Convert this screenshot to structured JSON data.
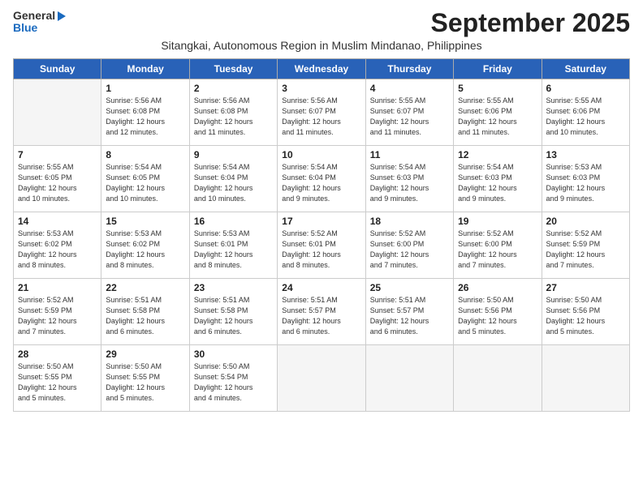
{
  "logo": {
    "general": "General",
    "blue": "Blue"
  },
  "title": "September 2025",
  "subtitle": "Sitangkai, Autonomous Region in Muslim Mindanao, Philippines",
  "days_of_week": [
    "Sunday",
    "Monday",
    "Tuesday",
    "Wednesday",
    "Thursday",
    "Friday",
    "Saturday"
  ],
  "weeks": [
    [
      {
        "day": "",
        "info": ""
      },
      {
        "day": "1",
        "info": "Sunrise: 5:56 AM\nSunset: 6:08 PM\nDaylight: 12 hours\nand 12 minutes."
      },
      {
        "day": "2",
        "info": "Sunrise: 5:56 AM\nSunset: 6:08 PM\nDaylight: 12 hours\nand 11 minutes."
      },
      {
        "day": "3",
        "info": "Sunrise: 5:56 AM\nSunset: 6:07 PM\nDaylight: 12 hours\nand 11 minutes."
      },
      {
        "day": "4",
        "info": "Sunrise: 5:55 AM\nSunset: 6:07 PM\nDaylight: 12 hours\nand 11 minutes."
      },
      {
        "day": "5",
        "info": "Sunrise: 5:55 AM\nSunset: 6:06 PM\nDaylight: 12 hours\nand 11 minutes."
      },
      {
        "day": "6",
        "info": "Sunrise: 5:55 AM\nSunset: 6:06 PM\nDaylight: 12 hours\nand 10 minutes."
      }
    ],
    [
      {
        "day": "7",
        "info": "Sunrise: 5:55 AM\nSunset: 6:05 PM\nDaylight: 12 hours\nand 10 minutes."
      },
      {
        "day": "8",
        "info": "Sunrise: 5:54 AM\nSunset: 6:05 PM\nDaylight: 12 hours\nand 10 minutes."
      },
      {
        "day": "9",
        "info": "Sunrise: 5:54 AM\nSunset: 6:04 PM\nDaylight: 12 hours\nand 10 minutes."
      },
      {
        "day": "10",
        "info": "Sunrise: 5:54 AM\nSunset: 6:04 PM\nDaylight: 12 hours\nand 9 minutes."
      },
      {
        "day": "11",
        "info": "Sunrise: 5:54 AM\nSunset: 6:03 PM\nDaylight: 12 hours\nand 9 minutes."
      },
      {
        "day": "12",
        "info": "Sunrise: 5:54 AM\nSunset: 6:03 PM\nDaylight: 12 hours\nand 9 minutes."
      },
      {
        "day": "13",
        "info": "Sunrise: 5:53 AM\nSunset: 6:03 PM\nDaylight: 12 hours\nand 9 minutes."
      }
    ],
    [
      {
        "day": "14",
        "info": "Sunrise: 5:53 AM\nSunset: 6:02 PM\nDaylight: 12 hours\nand 8 minutes."
      },
      {
        "day": "15",
        "info": "Sunrise: 5:53 AM\nSunset: 6:02 PM\nDaylight: 12 hours\nand 8 minutes."
      },
      {
        "day": "16",
        "info": "Sunrise: 5:53 AM\nSunset: 6:01 PM\nDaylight: 12 hours\nand 8 minutes."
      },
      {
        "day": "17",
        "info": "Sunrise: 5:52 AM\nSunset: 6:01 PM\nDaylight: 12 hours\nand 8 minutes."
      },
      {
        "day": "18",
        "info": "Sunrise: 5:52 AM\nSunset: 6:00 PM\nDaylight: 12 hours\nand 7 minutes."
      },
      {
        "day": "19",
        "info": "Sunrise: 5:52 AM\nSunset: 6:00 PM\nDaylight: 12 hours\nand 7 minutes."
      },
      {
        "day": "20",
        "info": "Sunrise: 5:52 AM\nSunset: 5:59 PM\nDaylight: 12 hours\nand 7 minutes."
      }
    ],
    [
      {
        "day": "21",
        "info": "Sunrise: 5:52 AM\nSunset: 5:59 PM\nDaylight: 12 hours\nand 7 minutes."
      },
      {
        "day": "22",
        "info": "Sunrise: 5:51 AM\nSunset: 5:58 PM\nDaylight: 12 hours\nand 6 minutes."
      },
      {
        "day": "23",
        "info": "Sunrise: 5:51 AM\nSunset: 5:58 PM\nDaylight: 12 hours\nand 6 minutes."
      },
      {
        "day": "24",
        "info": "Sunrise: 5:51 AM\nSunset: 5:57 PM\nDaylight: 12 hours\nand 6 minutes."
      },
      {
        "day": "25",
        "info": "Sunrise: 5:51 AM\nSunset: 5:57 PM\nDaylight: 12 hours\nand 6 minutes."
      },
      {
        "day": "26",
        "info": "Sunrise: 5:50 AM\nSunset: 5:56 PM\nDaylight: 12 hours\nand 5 minutes."
      },
      {
        "day": "27",
        "info": "Sunrise: 5:50 AM\nSunset: 5:56 PM\nDaylight: 12 hours\nand 5 minutes."
      }
    ],
    [
      {
        "day": "28",
        "info": "Sunrise: 5:50 AM\nSunset: 5:55 PM\nDaylight: 12 hours\nand 5 minutes."
      },
      {
        "day": "29",
        "info": "Sunrise: 5:50 AM\nSunset: 5:55 PM\nDaylight: 12 hours\nand 5 minutes."
      },
      {
        "day": "30",
        "info": "Sunrise: 5:50 AM\nSunset: 5:54 PM\nDaylight: 12 hours\nand 4 minutes."
      },
      {
        "day": "",
        "info": ""
      },
      {
        "day": "",
        "info": ""
      },
      {
        "day": "",
        "info": ""
      },
      {
        "day": "",
        "info": ""
      }
    ]
  ]
}
